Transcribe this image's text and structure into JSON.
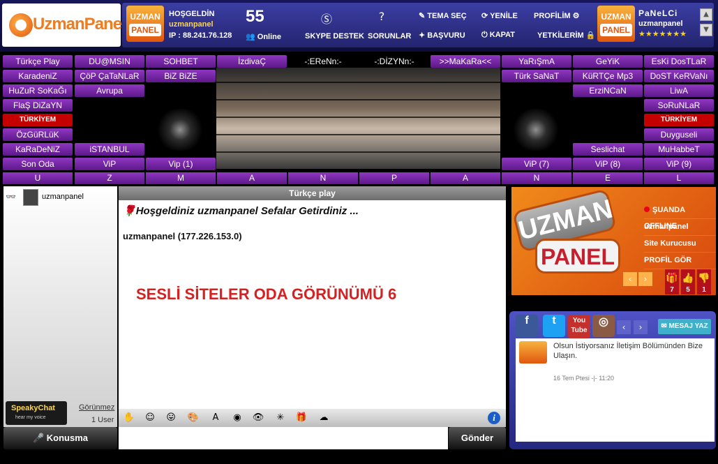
{
  "header": {
    "logo": "UzmanPanel",
    "mini_logo_top": "UZMAN",
    "mini_logo_bottom": "PANEL",
    "greeting": "HOŞGELDİN",
    "username": "uzmanpanel",
    "ip": "IP : 88.241.76.128",
    "online_count": "55",
    "online_label": "Online",
    "skype": "SKYPE DESTEK",
    "faq": "SORUNLAR",
    "theme": "TEMA SEÇ",
    "refresh": "YENİLE",
    "profile": "PROFİLİM",
    "apply": "BAŞVURU",
    "close": "KAPAT",
    "perms": "YETKİLERİM",
    "admin_name": "PaNeLCi",
    "admin_user": "uzmanpanel",
    "stars": "★★★★★★★"
  },
  "rooms": {
    "col1": [
      "Türkçe Play",
      "KaradeniZ",
      "HuZuR SoKaĞı",
      "FlaŞ DiZaYN",
      "TÜRKİYEM",
      "ÖzGüRLüK",
      "KaRaDeNiZ",
      "Son Oda"
    ],
    "col2": [
      "DU@MSIN",
      "ÇöP ÇaTaNLaR",
      "Avrupa",
      "",
      "",
      "",
      "iSTANBUL",
      "ViP"
    ],
    "col3": [
      "SOHBET",
      "BiZ BiZE",
      "",
      "",
      "",
      "",
      "",
      "Vip (1)"
    ],
    "top_mid": [
      "İzdivaÇ",
      "-:EReNn:-",
      "-:DİZYNn:-",
      ">>MaKaRa<<"
    ],
    "col8": [
      "YaRıŞmA",
      "Türk SaNaT",
      "",
      "",
      "",
      "",
      "",
      "ViP (7)"
    ],
    "col9": [
      "GeYiK",
      "KüRTÇe Mp3",
      "ErziNCaN",
      "",
      "",
      "",
      "Seslichat",
      "ViP (8)"
    ],
    "col10": [
      "EsKi DosTLaR",
      "DoST KeRVaNı",
      "LiwA",
      "SoRuNLaR",
      "TÜRKİYEM",
      "Duyguseli",
      "MuHabbeT",
      "ViP (9)"
    ],
    "letters": [
      "U",
      "Z",
      "M",
      "A",
      "N",
      "P",
      "A",
      "N",
      "E",
      "L"
    ]
  },
  "users": {
    "name": "uzmanpanel",
    "invisible": "Görünmez",
    "count": "1 User",
    "speaky_title": "SpeakyChat",
    "speaky_sub": "hear my voice",
    "talk": "Konusma"
  },
  "chat": {
    "room": "Türkçe play",
    "welcome": "Hoşgeldiniz uzmanpanel Sefalar Getirdiniz ...",
    "userip": "uzmanpanel (177.226.153.0)",
    "overlay": "SESLİ SİTELER ODA GÖRÜNÜMÜ 6",
    "send": "Gönder"
  },
  "profile": {
    "status": "ŞUANDA OFFLINE",
    "user": "uzmanpanel",
    "role": "Site Kurucusu",
    "view": "PROFİL GÖR",
    "logo_top": "UZMAN",
    "logo_bottom": "PANEL",
    "gift": "7",
    "like": "5",
    "dislike": "1"
  },
  "social": {
    "msg": "MESAJ YAZ",
    "youtube": "You Tube",
    "news": "Olsun İstiyorsanız İletişim Bölümünden Bize Ulaşın.",
    "date": "16 Tem Ptesi -|- 11:20"
  },
  "colors": {
    "room_btn": "#7a2aa8",
    "accent": "#f08a1b",
    "header": "#2a2c86"
  }
}
